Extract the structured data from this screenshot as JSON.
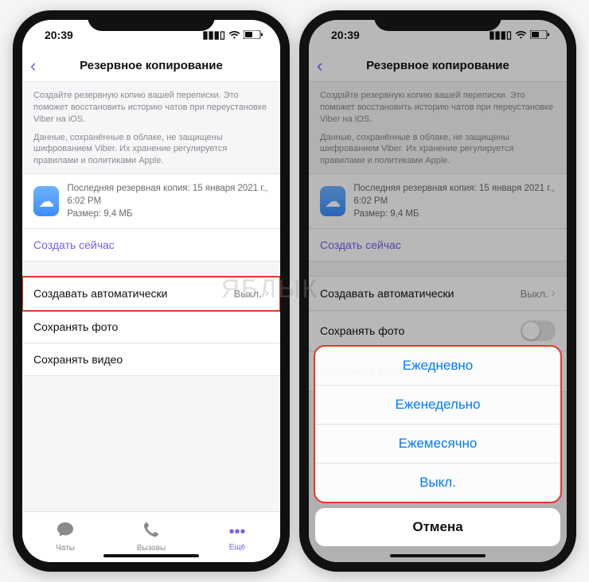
{
  "statusbar": {
    "time": "20:39"
  },
  "header": {
    "title": "Резервное копирование"
  },
  "desc1": "Создайте резервную копию вашей переписки. Это поможет восстановить историю чатов при переустановке Viber на iOS.",
  "desc2": "Данные, сохранённые в облаке, не защищены шифрованием Viber. Их хранение регулируется правилами и политиками Apple.",
  "backup": {
    "last_label": "Последняя резервная копия: 15 января 2021 г., 6:02 PM",
    "size_label": "Размер: 9,4 МБ",
    "create_now": "Создать сейчас"
  },
  "rows": {
    "auto_label": "Создавать автоматически",
    "auto_value": "Выкл.",
    "save_photo": "Сохранять фото",
    "save_video": "Сохранять видео"
  },
  "tabs": {
    "chats": "Чаты",
    "calls": "Вызовы",
    "more": "Ещё"
  },
  "sheet": {
    "items": [
      "Ежедневно",
      "Еженедельно",
      "Ежемесячно",
      "Выкл."
    ],
    "cancel": "Отмена"
  },
  "watermark": "ЯБЛЫК"
}
